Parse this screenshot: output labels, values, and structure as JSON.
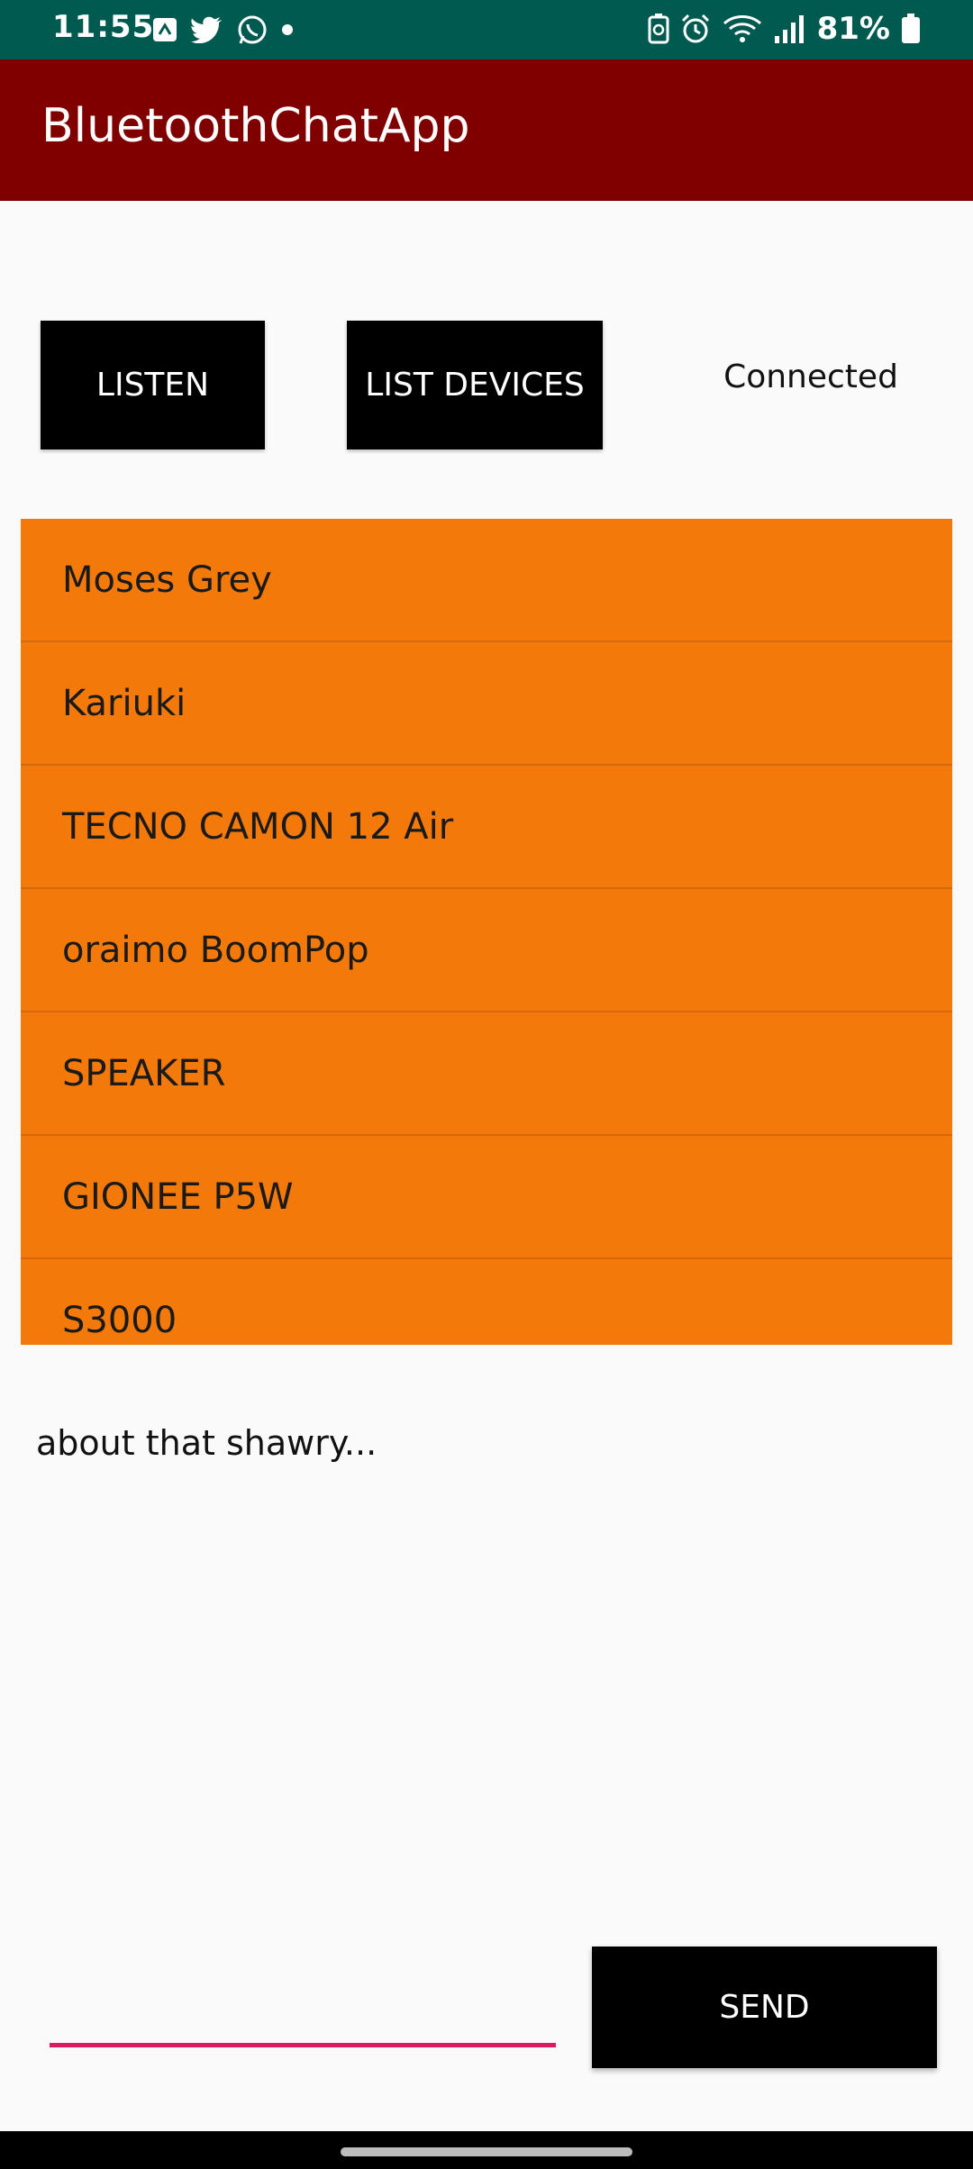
{
  "status_bar": {
    "time": "11:55",
    "battery": "81%",
    "left_icons": [
      "sync-icon",
      "twitter-icon",
      "whatsapp-icon",
      "dot-icon"
    ],
    "right_icons": [
      "battery-saver-icon",
      "alarm-icon",
      "wifi-icon",
      "signal-icon",
      "battery-icon"
    ]
  },
  "app_bar": {
    "title": "BluetoothChatApp"
  },
  "controls": {
    "listen_label": "LISTEN",
    "list_devices_label": "LIST DEVICES",
    "status_text": "Connected"
  },
  "devices": [
    "Moses Grey",
    "Kariuki",
    "TECNO CAMON 12 Air",
    "oraimo BoomPop",
    "SPEAKER",
    "GIONEE P5W",
    "S3000"
  ],
  "chat": {
    "message": "about that shawry...",
    "input_value": "",
    "send_label": "SEND"
  },
  "colors": {
    "status_bar": "#005a4f",
    "app_bar": "#800000",
    "list_background": "#f4790b",
    "input_underline": "#d81b60",
    "button": "#000000"
  }
}
